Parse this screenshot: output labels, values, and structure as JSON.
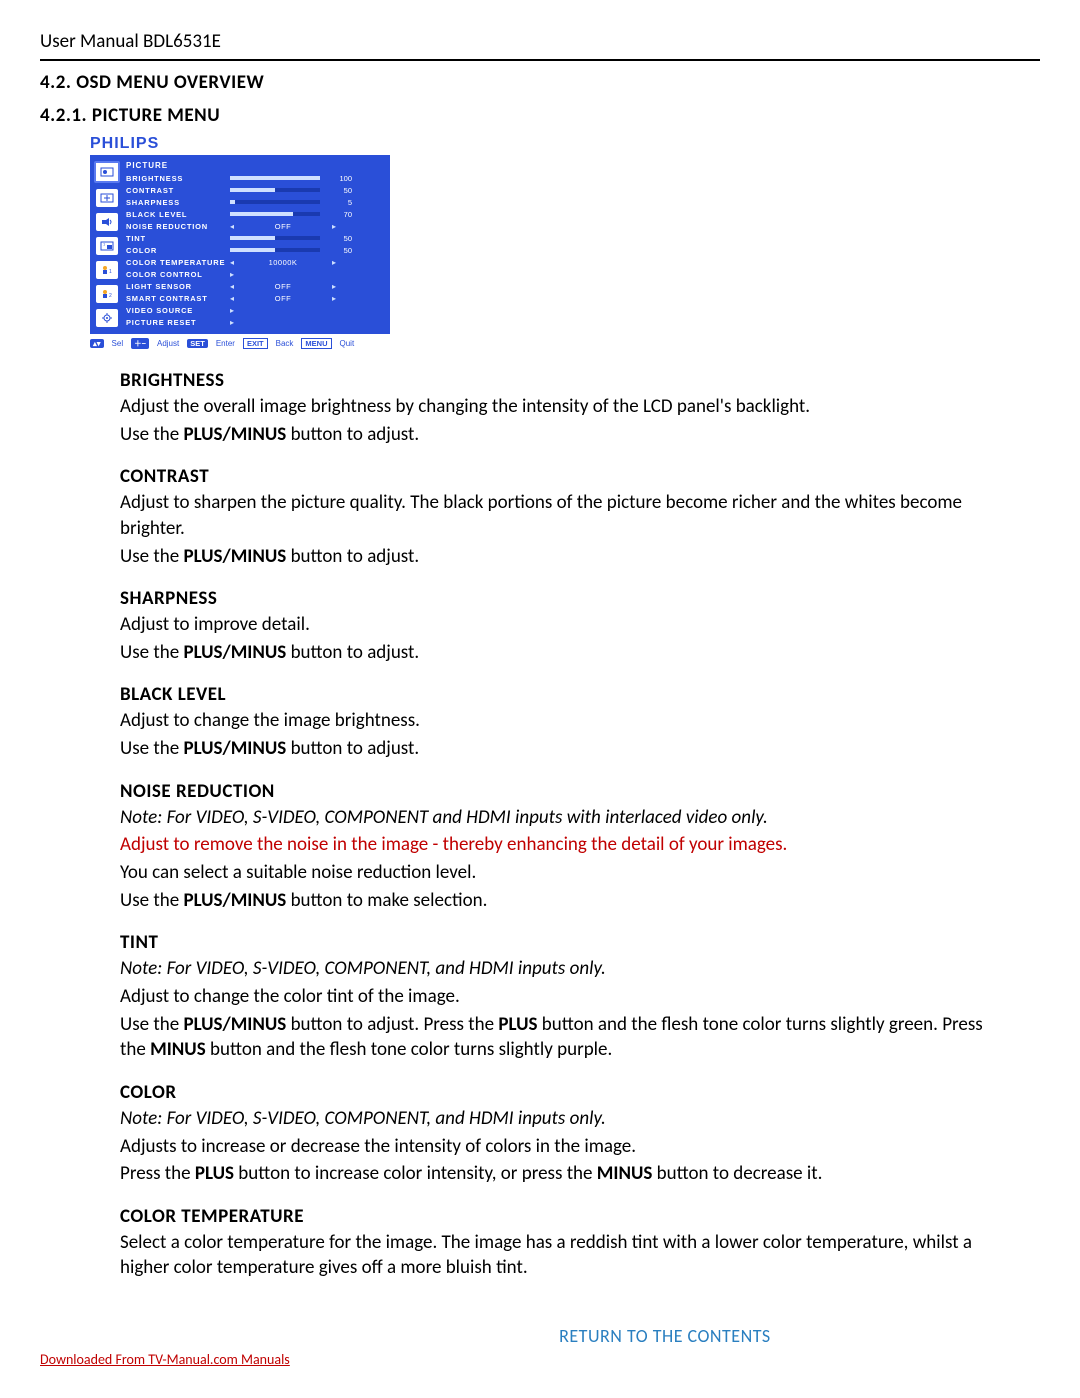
{
  "header": {
    "title": "User Manual BDL6531E"
  },
  "sections": {
    "s42": "4.2.    OSD MENU OVERVIEW",
    "s421": "4.2.1.    PICTURE MENU"
  },
  "osd": {
    "brand": "PHILIPS",
    "category": "PICTURE",
    "rows": [
      {
        "label": "BRIGHTNESS",
        "type": "bar",
        "value": 100,
        "fill": 100
      },
      {
        "label": "CONTRAST",
        "type": "bar",
        "value": 50,
        "fill": 50
      },
      {
        "label": "SHARPNESS",
        "type": "bar",
        "value": 5,
        "fill": 5
      },
      {
        "label": "BLACK LEVEL",
        "type": "bar",
        "value": 70,
        "fill": 70
      },
      {
        "label": "NOISE REDUCTION",
        "type": "enum",
        "value": "OFF"
      },
      {
        "label": "TINT",
        "type": "bar",
        "value": 50,
        "fill": 50
      },
      {
        "label": "COLOR",
        "type": "bar",
        "value": 50,
        "fill": 50
      },
      {
        "label": "COLOR TEMPERATURE",
        "type": "enum",
        "value": "10000K"
      },
      {
        "label": "COLOR CONTROL",
        "type": "sub"
      },
      {
        "label": "LIGHT SENSOR",
        "type": "enum",
        "value": "OFF"
      },
      {
        "label": "SMART CONTRAST",
        "type": "enum",
        "value": "OFF"
      },
      {
        "label": "VIDEO SOURCE",
        "type": "sub"
      },
      {
        "label": "PICTURE RESET",
        "type": "sub"
      }
    ],
    "hints": {
      "sel": "Sel",
      "adjust": "Adjust",
      "set": "SET",
      "enter": "Enter",
      "exit": "EXIT",
      "back": "Back",
      "menu": "MENU",
      "quit": "Quit"
    }
  },
  "body": {
    "brightness": {
      "h": "BRIGHTNESS",
      "p1a": "Adjust the overall image brightness by changing the intensity of the LCD panel's backlight.",
      "p2a": "Use the ",
      "p2b": "PLUS/MINUS",
      "p2c": " button to adjust."
    },
    "contrast": {
      "h": "CONTRAST",
      "p1": "Adjust to sharpen the picture quality. The black portions of the picture become richer and the whites become brighter.",
      "p2a": "Use the ",
      "p2b": "PLUS/MINUS",
      "p2c": " button to adjust."
    },
    "sharpness": {
      "h": "SHARPNESS",
      "p1": "Adjust to improve detail.",
      "p2a": "Use the ",
      "p2b": "PLUS/MINUS",
      "p2c": " button to adjust."
    },
    "blacklevel": {
      "h": "BLACK LEVEL",
      "p1": "Adjust to change the image brightness.",
      "p2a": "Use the ",
      "p2b": "PLUS/MINUS",
      "p2c": " button to adjust."
    },
    "noise": {
      "h": "NOISE REDUCTION",
      "note": "Note: For VIDEO, S-VIDEO, COMPONENT and HDMI inputs with interlaced video only.",
      "red": "Adjust to remove the noise in the image - thereby enhancing the detail of your images.",
      "p1": "You can select a suitable noise reduction level.",
      "p2a": "Use the ",
      "p2b": "PLUS/MINUS",
      "p2c": " button to make selection."
    },
    "tint": {
      "h": "TINT",
      "note": "Note: For VIDEO, S-VIDEO, COMPONENT, and HDMI inputs only.",
      "p1": "Adjust to change the color tint of the image.",
      "p2a": "Use the ",
      "p2b": "PLUS/MINUS",
      "p2c": " button to adjust. Press the ",
      "p2d": "PLUS",
      "p2e": " button and the flesh tone color turns slightly green. Press the ",
      "p2f": "MINUS",
      "p2g": " button and the flesh tone color turns slightly purple."
    },
    "color": {
      "h": "COLOR",
      "note": "Note: For VIDEO, S-VIDEO, COMPONENT, and HDMI inputs only.",
      "p1": "Adjusts to increase or decrease the intensity of colors in the image.",
      "p2a": "Press the ",
      "p2b": "PLUS",
      "p2c": " button to increase color intensity, or press the ",
      "p2d": "MINUS",
      "p2e": " button to decrease it."
    },
    "colortemp": {
      "h": "COLOR TEMPERATURE",
      "p1": "Select a color temperature for the image. The image has a reddish tint with a lower color temperature, whilst a higher color temperature gives off a more bluish tint."
    }
  },
  "footer": {
    "download": "Downloaded From TV-Manual.com Manuals",
    "return": "RETURN TO THE CONTENTS"
  }
}
